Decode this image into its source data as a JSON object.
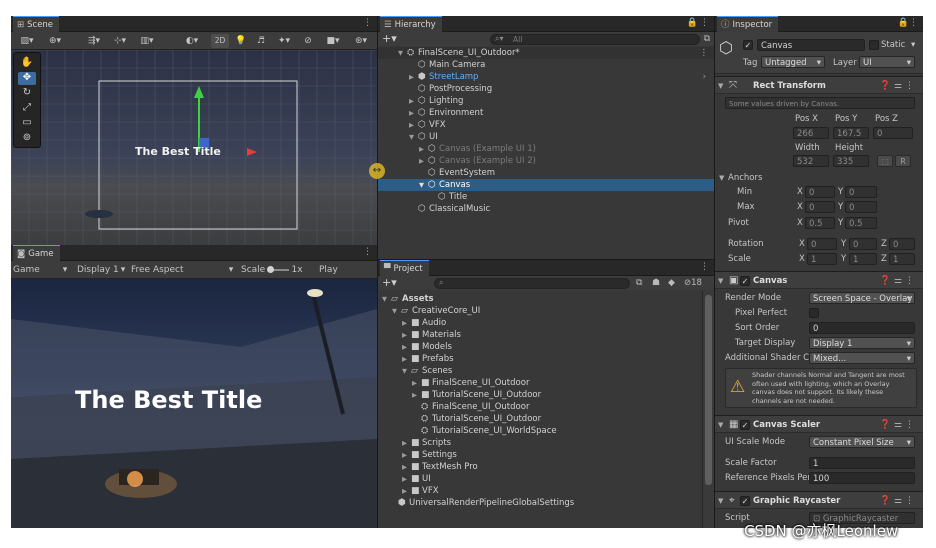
{
  "scene": {
    "tab_label": "Scene",
    "toolbar": {
      "two_d_label": "2D"
    },
    "title_text": "The Best Title"
  },
  "game": {
    "tab_label": "Game",
    "view_select": "Game",
    "display_select": "Display 1",
    "aspect_select": "Free Aspect",
    "scale_label": "Scale",
    "scale_value": "1x",
    "play_focused": "Play Focused",
    "title_text": "The Best Title"
  },
  "hierarchy": {
    "tab_label": "Hierarchy",
    "search_placeholder": "All",
    "rows": [
      {
        "label": "FinalScene_UI_Outdoor*"
      },
      {
        "label": "Main Camera"
      },
      {
        "label": "StreetLamp"
      },
      {
        "label": "PostProcessing"
      },
      {
        "label": "Lighting"
      },
      {
        "label": "Environment"
      },
      {
        "label": "VFX"
      },
      {
        "label": "UI"
      },
      {
        "label": "Canvas (Example UI 1)"
      },
      {
        "label": "Canvas (Example UI 2)"
      },
      {
        "label": "EventSystem"
      },
      {
        "label": "Canvas"
      },
      {
        "label": "Title"
      },
      {
        "label": "ClassicalMusic"
      }
    ]
  },
  "project": {
    "tab_label": "Project",
    "hidden_count": "18",
    "rows": [
      {
        "label": "Assets"
      },
      {
        "label": "CreativeCore_UI"
      },
      {
        "label": "Audio"
      },
      {
        "label": "Materials"
      },
      {
        "label": "Models"
      },
      {
        "label": "Prefabs"
      },
      {
        "label": "Scenes"
      },
      {
        "label": "FinalScene_UI_Outdoor"
      },
      {
        "label": "TutorialScene_UI_Outdoor"
      },
      {
        "label": "FinalScene_UI_Outdoor"
      },
      {
        "label": "TutorialScene_UI_Outdoor"
      },
      {
        "label": "TutorialScene_UI_WorldSpace"
      },
      {
        "label": "Scripts"
      },
      {
        "label": "Settings"
      },
      {
        "label": "TextMesh Pro"
      },
      {
        "label": "UI"
      },
      {
        "label": "VFX"
      },
      {
        "label": "UniversalRenderPipelineGlobalSettings"
      }
    ]
  },
  "inspector": {
    "tab_label": "Inspector",
    "object_name": "Canvas",
    "static_label": "Static",
    "tag_label": "Tag",
    "tag_value": "Untagged",
    "layer_label": "Layer",
    "layer_value": "UI",
    "rect_transform": {
      "title": "Rect Transform",
      "note": "Some values driven by Canvas.",
      "pos_x_label": "Pos X",
      "pos_y_label": "Pos Y",
      "pos_z_label": "Pos Z",
      "pos_x": "266",
      "pos_y": "167.5",
      "pos_z": "0",
      "width_label": "Width",
      "height_label": "Height",
      "width": "532",
      "height": "335",
      "r_button": "R",
      "anchors_label": "Anchors",
      "min_label": "Min",
      "max_label": "Max",
      "x_label": "X",
      "y_label": "Y",
      "z_label": "Z",
      "min_x": "0",
      "min_y": "0",
      "max_x": "0",
      "max_y": "0",
      "pivot_label": "Pivot",
      "pivot_x": "0.5",
      "pivot_y": "0.5",
      "rotation_label": "Rotation",
      "rot_x": "0",
      "rot_y": "0",
      "rot_z": "0",
      "scale_label": "Scale",
      "scale_x": "1",
      "scale_y": "1",
      "scale_z": "1"
    },
    "canvas": {
      "title": "Canvas",
      "render_mode_label": "Render Mode",
      "render_mode_value": "Screen Space - Overlay",
      "pixel_perfect_label": "Pixel Perfect",
      "sort_order_label": "Sort Order",
      "sort_order_value": "0",
      "target_display_label": "Target Display",
      "target_display_value": "Display 1",
      "shader_channels_label": "Additional Shader Ch",
      "shader_channels_value": "Mixed...",
      "warning": "Shader channels Normal and Tangent are most often used with lighting, which an Overlay canvas does not support. Its likely these channels are not needed."
    },
    "canvas_scaler": {
      "title": "Canvas Scaler",
      "ui_scale_mode_label": "UI Scale Mode",
      "ui_scale_mode_value": "Constant Pixel Size",
      "scale_factor_label": "Scale Factor",
      "scale_factor_value": "1",
      "ref_pixels_label": "Reference Pixels Per",
      "ref_pixels_value": "100"
    },
    "graphic_raycaster": {
      "title": "Graphic Raycaster",
      "script_label": "Script",
      "script_value": "GraphicRaycaster"
    }
  },
  "watermark": "CSDN @亦枫Leonlew"
}
